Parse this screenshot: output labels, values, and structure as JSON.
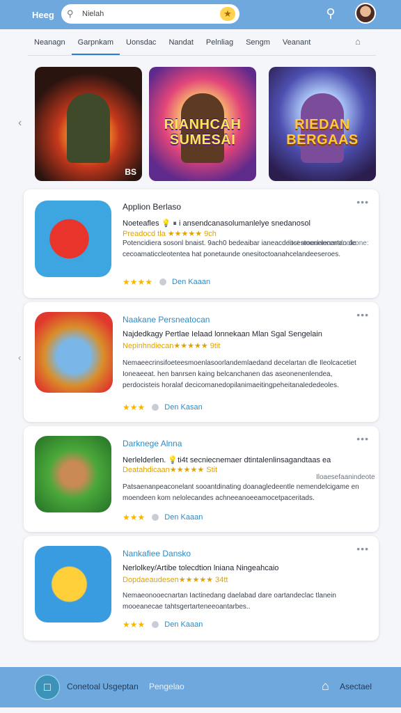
{
  "header": {
    "brand": "Heeg",
    "search_value": "Nielah",
    "search_placeholder": "Nielah"
  },
  "tabs": [
    "Neanagn",
    "Garpnkam",
    "Uonsdac",
    "Nandat",
    "Pelnliag",
    "Sengm",
    "Veanant"
  ],
  "featured": [
    {
      "title": "",
      "corner": "BS"
    },
    {
      "title": "RIANHCAH SUMESAI",
      "corner": ""
    },
    {
      "title": "RIEDAN BERGAAS",
      "corner": ""
    }
  ],
  "apps": [
    {
      "name": "Applion Berlaso",
      "sub": "Noeteafles 💡 ⏸ i ansendcanasolumanlelye snedanosol",
      "rating": "Preadocd tla ★★★★★  9ch",
      "desc": "Potencidiera sosonl bnaist.   9ach0\nbedeaibar ianeacdeitcestoonelenartan de cecoamaticcleotentea hat ponetaunde onesitoctoanahcelandeeseroes.",
      "meta": "lost amedancenalcolcone:",
      "stars": "★★★★",
      "link": "Den Kaaan"
    },
    {
      "name": "Naakane Persneatocan",
      "sub": "Najdedkagy Pertlae Ielaad lonnekaan Mlan Sgal Sengelain",
      "rating": "Nepinhndiecan★★★★★  9tit",
      "desc": "Nemaeecrinsifoeteesmoenlasoorlandemlaedand decelartan dle Ileolcacetiet Ioneaeeat. hen banrsen kaing belcanchanen das aseonenenlendea, perdocisteis horalaf decicomanedopilanimaeitingpeheitanalededeoles.",
      "meta": "",
      "stars": "★★★",
      "link": "Den Kasan"
    },
    {
      "name": "Darknege Alnna",
      "sub": "Nerlelderlen.  💡ti4t secniecnemaer dtintalenlinsagandtaas ea",
      "rating": "Deatahdicaan★★★★★  Stit",
      "desc": "Patsaenanpeaconelant sooantdinating doanagledeentle nemendelcigame en moendeen kom nelolecandes achneeanoeeamocetpaceritads.",
      "meta": "Iloaesefaanindeote",
      "stars": "★★★",
      "link": "Den Kaaan"
    },
    {
      "name": "Nankafiee Dansko",
      "sub": "Nerlolkey/Artibe tolecdtion lniana Ningeahcaio",
      "rating": "Dopdaeaudesen★★★★★  34tt",
      "desc": "Nemaeonooecnartan Iactinedang daelabad dare oartandeclac tlanein mooeanecae tahtsgertarteneeoantarbes..",
      "meta": "",
      "stars": "★★★",
      "link": "Den Kaaan"
    }
  ],
  "bottom_bar": {
    "primary": "Conetoal Usgeptan",
    "secondary": "Pengelao",
    "right": "Asectael"
  }
}
